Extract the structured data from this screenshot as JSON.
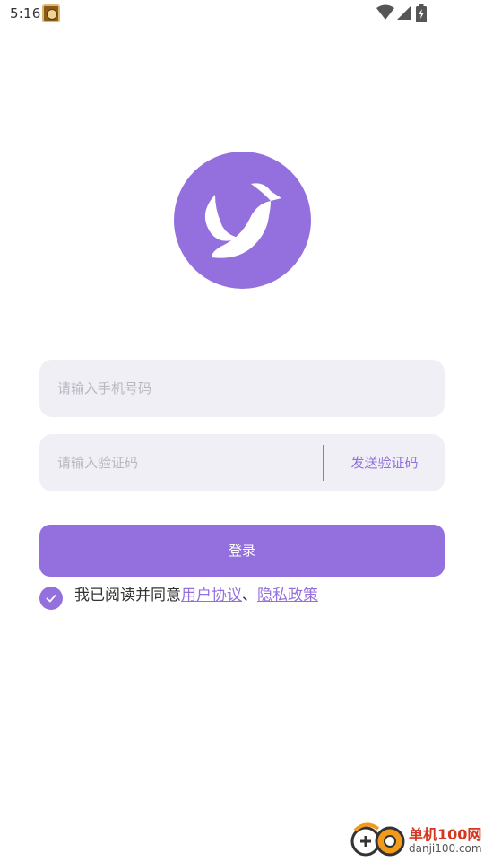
{
  "status_bar": {
    "time": "5:16",
    "notification_icon": "app-notification-icon",
    "icons": [
      "wifi-icon",
      "cellular-signal-icon",
      "battery-charging-icon"
    ]
  },
  "logo": {
    "icon": "bird-logo-icon",
    "background_color": "#9470de"
  },
  "form": {
    "phone_placeholder": "请输入手机号码",
    "phone_value": "",
    "code_placeholder": "请输入验证码",
    "code_value": "",
    "send_code_label": "发送验证码",
    "login_label": "登录"
  },
  "agreement": {
    "checked": true,
    "prefix": "我已阅读并同意",
    "user_agreement": "用户协议",
    "separator": "、",
    "privacy_policy": "隐私政策"
  },
  "watermark": {
    "name": "单机100网",
    "url": "danji100.com"
  },
  "colors": {
    "accent": "#9470de",
    "input_background": "#f0eff6",
    "placeholder": "#b9b8c2"
  }
}
